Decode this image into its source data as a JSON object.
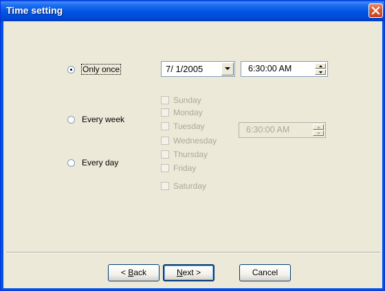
{
  "window": {
    "title": "Time setting"
  },
  "options": [
    {
      "label": "Only once",
      "selected": true
    },
    {
      "label": "Every week",
      "selected": false
    },
    {
      "label": "Every day",
      "selected": false
    }
  ],
  "once": {
    "date": "7/ 1/2005",
    "time": "6:30:00 AM"
  },
  "weekly": {
    "days": [
      "Sunday",
      "Monday",
      "Tuesday",
      "Wednesday",
      "Thursday",
      "Friday",
      "Saturday"
    ],
    "time": "6:30:00 AM"
  },
  "buttons": {
    "back": {
      "mnemonic": "B",
      "rest": "ack",
      "prefix": "< "
    },
    "next": {
      "mnemonic": "N",
      "rest": "ext >"
    },
    "cancel": "Cancel"
  }
}
